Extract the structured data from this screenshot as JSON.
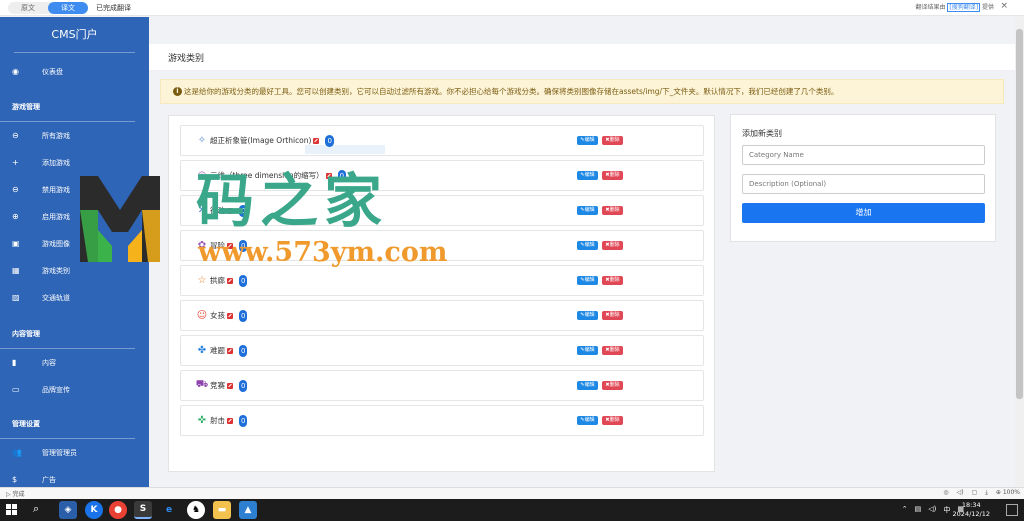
{
  "translate_bar": {
    "tab_original": "原文",
    "tab_translated": "译文",
    "status": "已完成翻译",
    "result_from": "翻译结果由",
    "provider": "[搜狗翻译]",
    "provided": "提供",
    "close": "×"
  },
  "sidebar": {
    "brand": "CMS门户",
    "items_top": [
      {
        "label": "仪表盘",
        "icon": "dashboard-icon",
        "glyph": "◉"
      }
    ],
    "section_game": "游戏管理",
    "items_game": [
      {
        "label": "所有游戏",
        "icon": "gamepad-icon",
        "glyph": "⊖"
      },
      {
        "label": "添加游戏",
        "icon": "plus-icon",
        "glyph": "+"
      },
      {
        "label": "禁用游戏",
        "icon": "minus-circle-icon",
        "glyph": "⊖"
      },
      {
        "label": "启用游戏",
        "icon": "plus-circle-icon",
        "glyph": "⊕"
      },
      {
        "label": "游戏图像",
        "icon": "image-file-icon",
        "glyph": "▣"
      },
      {
        "label": "游戏类别",
        "icon": "grid-icon",
        "glyph": "▦"
      },
      {
        "label": "交通轨道",
        "icon": "map-icon",
        "glyph": "▨"
      }
    ],
    "section_content": "内容管理",
    "items_content": [
      {
        "label": "内容",
        "icon": "bookmark-icon",
        "glyph": "▮"
      },
      {
        "label": "品牌宣传",
        "icon": "card-icon",
        "glyph": "▭"
      }
    ],
    "section_admin": "管理设置",
    "items_admin": [
      {
        "label": "管理管理员",
        "icon": "users-icon",
        "glyph": "👥"
      },
      {
        "label": "广告",
        "icon": "dollar-icon",
        "glyph": "$"
      }
    ]
  },
  "page": {
    "title": "游戏类别",
    "notice": "这是给你的游戏分类的最好工具。您可以创建类别，它可以自动过滤所有游戏。你不必担心给每个游戏分类。确保将类别图像存储在assets/img/下_文件夹。默认情况下，我们已经创建了几个类别。"
  },
  "categories": [
    {
      "name": "超正析象管(Image Orthicon)",
      "count": "0",
      "icon": "orthicon-icon",
      "glyph": "✧",
      "color": "#5b8fd6"
    },
    {
      "name": "三维（three dimension的缩写）",
      "count": "0",
      "icon": "3d-icon",
      "glyph": "◎",
      "color": "#9b59b6"
    },
    {
      "name": "行动",
      "count": "0",
      "icon": "action-icon",
      "glyph": "✕",
      "color": "#3a7bd5"
    },
    {
      "name": "冒险",
      "count": "0",
      "icon": "adventure-icon",
      "glyph": "✿",
      "color": "#9b59b6"
    },
    {
      "name": "拱廊",
      "count": "0",
      "icon": "arcade-icon",
      "glyph": "☆",
      "color": "#e67e22"
    },
    {
      "name": "女孩",
      "count": "0",
      "icon": "girls-icon",
      "glyph": "☺",
      "color": "#e74c3c"
    },
    {
      "name": "难题",
      "count": "0",
      "icon": "puzzle-icon",
      "glyph": "✤",
      "color": "#2e86de"
    },
    {
      "name": "竞赛",
      "count": "0",
      "icon": "racing-icon",
      "glyph": "⛟",
      "color": "#8e44ad"
    },
    {
      "name": "射击",
      "count": "0",
      "icon": "shooting-icon",
      "glyph": "✜",
      "color": "#27ae60"
    }
  ],
  "actions": {
    "edit": "✎编辑",
    "delete": "✖删除"
  },
  "add_form": {
    "title": "添加新类别",
    "name_placeholder": "Category Name",
    "desc_placeholder": "Description (Optional)",
    "submit": "增加"
  },
  "statusbar": {
    "status": "完成",
    "zoom": "100%"
  },
  "taskbar": {
    "time": "18:34",
    "date": "2024/12/12",
    "ime": "中"
  },
  "watermark": {
    "title": "码之家",
    "url": "www.573ym.com"
  },
  "colors": {
    "sidebar": "#2f65b6",
    "primary": "#1976f0",
    "danger": "#e04856",
    "notice_bg": "#fdf4d8"
  }
}
